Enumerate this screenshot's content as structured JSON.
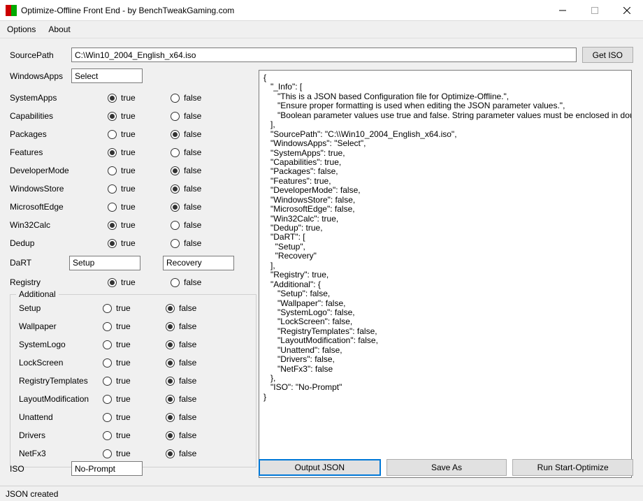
{
  "window": {
    "title": "Optimize-Offline Front End - by BenchTweakGaming.com"
  },
  "menu": {
    "options": "Options",
    "about": "About"
  },
  "sourcePath": {
    "label": "SourcePath",
    "value": "C:\\Win10_2004_English_x64.iso",
    "button": "Get ISO"
  },
  "windowsApps": {
    "label": "WindowsApps",
    "value": "Select"
  },
  "radioLabels": {
    "true": "true",
    "false": "false"
  },
  "options": [
    {
      "name": "SystemApps",
      "value": true
    },
    {
      "name": "Capabilities",
      "value": true
    },
    {
      "name": "Packages",
      "value": false
    },
    {
      "name": "Features",
      "value": true
    },
    {
      "name": "DeveloperMode",
      "value": false
    },
    {
      "name": "WindowsStore",
      "value": false
    },
    {
      "name": "MicrosoftEdge",
      "value": false
    },
    {
      "name": "Win32Calc",
      "value": true
    },
    {
      "name": "Dedup",
      "value": true
    }
  ],
  "dart": {
    "label": "DaRT",
    "val1": "Setup",
    "val2": "Recovery"
  },
  "registry": {
    "name": "Registry",
    "value": true
  },
  "additional": {
    "legend": "Additional",
    "items": [
      {
        "name": "Setup",
        "value": false
      },
      {
        "name": "Wallpaper",
        "value": false
      },
      {
        "name": "SystemLogo",
        "value": false
      },
      {
        "name": "LockScreen",
        "value": false
      },
      {
        "name": "RegistryTemplates",
        "value": false
      },
      {
        "name": "LayoutModification",
        "value": false
      },
      {
        "name": "Unattend",
        "value": false
      },
      {
        "name": "Drivers",
        "value": false
      },
      {
        "name": "NetFx3",
        "value": false
      }
    ]
  },
  "iso": {
    "label": "ISO",
    "value": "No-Prompt"
  },
  "jsonPreview": "{\n   \"_Info\": [\n      \"This is a JSON based Configuration file for Optimize-Offline.\",\n      \"Ensure proper formatting is used when editing the JSON parameter values.\",\n      \"Boolean parameter values use true and false. String parameter values must be enclosed in double-quotes.\"\n   ],\n   \"SourcePath\": \"C:\\\\Win10_2004_English_x64.iso\",\n   \"WindowsApps\": \"Select\",\n   \"SystemApps\": true,\n   \"Capabilities\": true,\n   \"Packages\": false,\n   \"Features\": true,\n   \"DeveloperMode\": false,\n   \"WindowsStore\": false,\n   \"MicrosoftEdge\": false,\n   \"Win32Calc\": true,\n   \"Dedup\": true,\n   \"DaRT\": [\n     \"Setup\",\n     \"Recovery\"\n   ],\n   \"Registry\": true,\n   \"Additional\": {\n      \"Setup\": false,\n      \"Wallpaper\": false,\n      \"SystemLogo\": false,\n      \"LockScreen\": false,\n      \"RegistryTemplates\": false,\n      \"LayoutModification\": false,\n      \"Unattend\": false,\n      \"Drivers\": false,\n      \"NetFx3\": false\n   },\n   \"ISO\": \"No-Prompt\"\n}",
  "buttons": {
    "outputJson": "Output JSON",
    "saveAs": "Save As",
    "runStart": "Run Start-Optimize"
  },
  "status": "JSON created"
}
